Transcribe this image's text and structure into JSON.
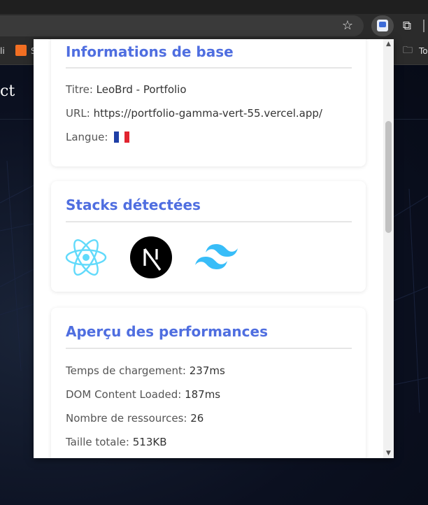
{
  "browser": {
    "bookmark_left_text": "li",
    "bookmark_s_text": "S",
    "bookmark_folder_label": "To",
    "star_glyph": "☆",
    "puzzle_glyph": "⧉",
    "folder_glyph": "🗀"
  },
  "page": {
    "title_partial": "ct"
  },
  "popup": {
    "base_info": {
      "title": "Informations de base",
      "rows": [
        {
          "label": "Titre:",
          "value": "LeoBrd - Portfolio"
        },
        {
          "label": "URL:",
          "value": "https://portfolio-gamma-vert-55.vercel.app/"
        },
        {
          "label": "Langue:",
          "value": ""
        }
      ],
      "language_flag": "french-flag"
    },
    "stacks": {
      "title": "Stacks détectées",
      "icons": [
        "react-icon",
        "nextjs-icon",
        "tailwind-icon"
      ]
    },
    "performance": {
      "title": "Aperçu des performances",
      "rows": [
        {
          "label": "Temps de chargement:",
          "value": "237ms"
        },
        {
          "label": "DOM Content Loaded:",
          "value": "187ms"
        },
        {
          "label": "Nombre de ressources:",
          "value": "26"
        },
        {
          "label": "Taille totale:",
          "value": "513KB"
        }
      ]
    }
  },
  "colors": {
    "accent": "#4f6ee0",
    "react": "#61dafb",
    "tailwind": "#38bdf8",
    "next_bg": "#000000"
  }
}
